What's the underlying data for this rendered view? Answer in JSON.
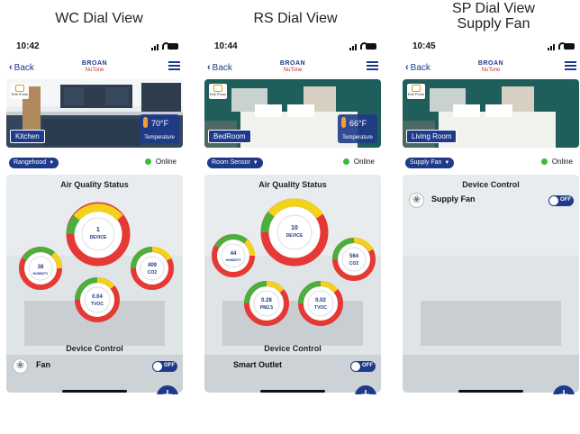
{
  "captions": [
    "WC Dial View",
    "RS Dial View",
    "SP Dial View\nSupply Fan"
  ],
  "brand": {
    "line1": "BROAN",
    "line2": "NuTone"
  },
  "nav": {
    "back": "Back"
  },
  "edit_photo": "Edit Photo",
  "phones": [
    {
      "time": "10:42",
      "room": "Kitchen",
      "temp": "70°F",
      "temp_label": "Temperature",
      "device": "Rangehood",
      "status": "Online",
      "aq_title": "Air Quality Status",
      "dials": [
        {
          "value": "1",
          "label": "DEVICE"
        },
        {
          "value": "38",
          "label": "HUMIDITY"
        },
        {
          "value": "409",
          "label": "CO2"
        },
        {
          "value": "0.04",
          "label": "TVOC"
        }
      ],
      "dc_title": "Device Control",
      "control_name": "Fan",
      "toggle": "OFF",
      "fab": "+"
    },
    {
      "time": "10:44",
      "room": "BedRoom",
      "temp": "66°F",
      "temp_label": "Temperature",
      "device": "Room Sensor",
      "status": "Online",
      "aq_title": "Air Quality Status",
      "dials": [
        {
          "value": "10",
          "label": "DEVICE"
        },
        {
          "value": "44",
          "label": "HUMIDITY"
        },
        {
          "value": "564",
          "label": "CO2"
        },
        {
          "value": "0.28",
          "label": "PM2.5"
        },
        {
          "value": "0.02",
          "label": "TVOC"
        }
      ],
      "dc_title": "Device Control",
      "control_name": "Smart Outlet",
      "toggle": "OFF",
      "fab": "+"
    },
    {
      "time": "10:45",
      "room": "Living Room",
      "device": "Supply Fan",
      "status": "Online",
      "dc_title": "Device Control",
      "control_name": "Supply Fan",
      "toggle": "OFF",
      "fab": "+"
    }
  ],
  "colors": {
    "primary": "#1e3a8a",
    "online": "#3db83d",
    "ring_red": "#e53935",
    "ring_yellow": "#f2d21b",
    "ring_green": "#4caf3b"
  }
}
